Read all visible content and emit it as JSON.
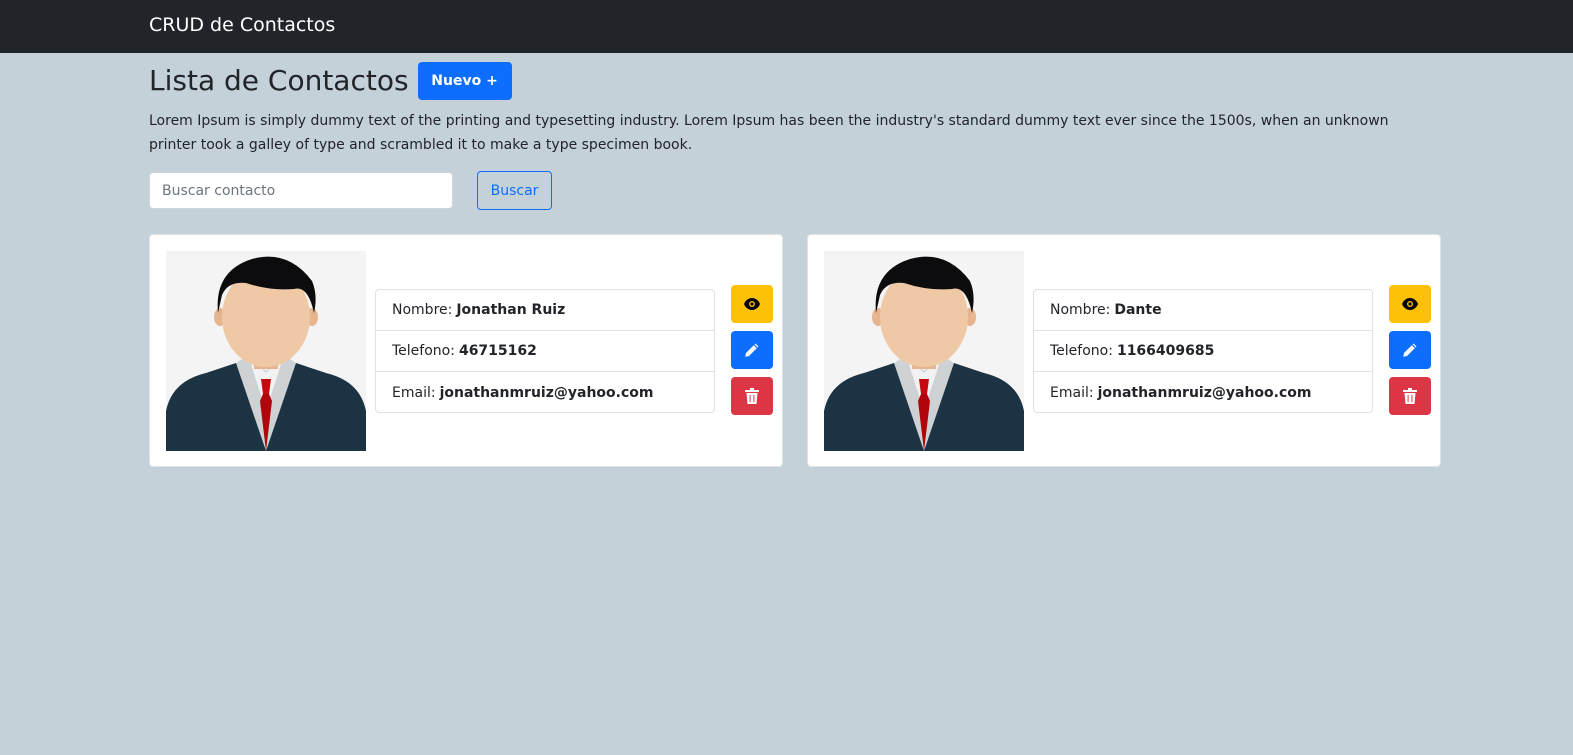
{
  "navbar": {
    "brand": "CRUD de Contactos"
  },
  "header": {
    "title": "Lista de Contactos",
    "new_button_label": "Nuevo +"
  },
  "description": "Lorem Ipsum is simply dummy text of the printing and typesetting industry. Lorem Ipsum has been the industry's standard dummy text ever since the 1500s, when an unknown printer took a galley of type and scrambled it to make a type specimen book.",
  "search": {
    "placeholder": "Buscar contacto",
    "value": "",
    "button_label": "Buscar"
  },
  "labels": {
    "name": "Nombre:",
    "phone": "Telefono:",
    "email": "Email:"
  },
  "contacts": [
    {
      "name": "Jonathan Ruiz",
      "phone": "46715162",
      "email": "jonathanmruiz@yahoo.com"
    },
    {
      "name": "Dante",
      "phone": "1166409685",
      "email": "jonathanmruiz@yahoo.com"
    }
  ],
  "icons": {
    "view": "eye-icon",
    "edit": "pencil-icon",
    "delete": "trash-icon"
  },
  "colors": {
    "navbar": "#212529",
    "background": "#c4d1d9",
    "primary": "#0d6efd",
    "warning": "#ffc107",
    "danger": "#dc3545"
  }
}
